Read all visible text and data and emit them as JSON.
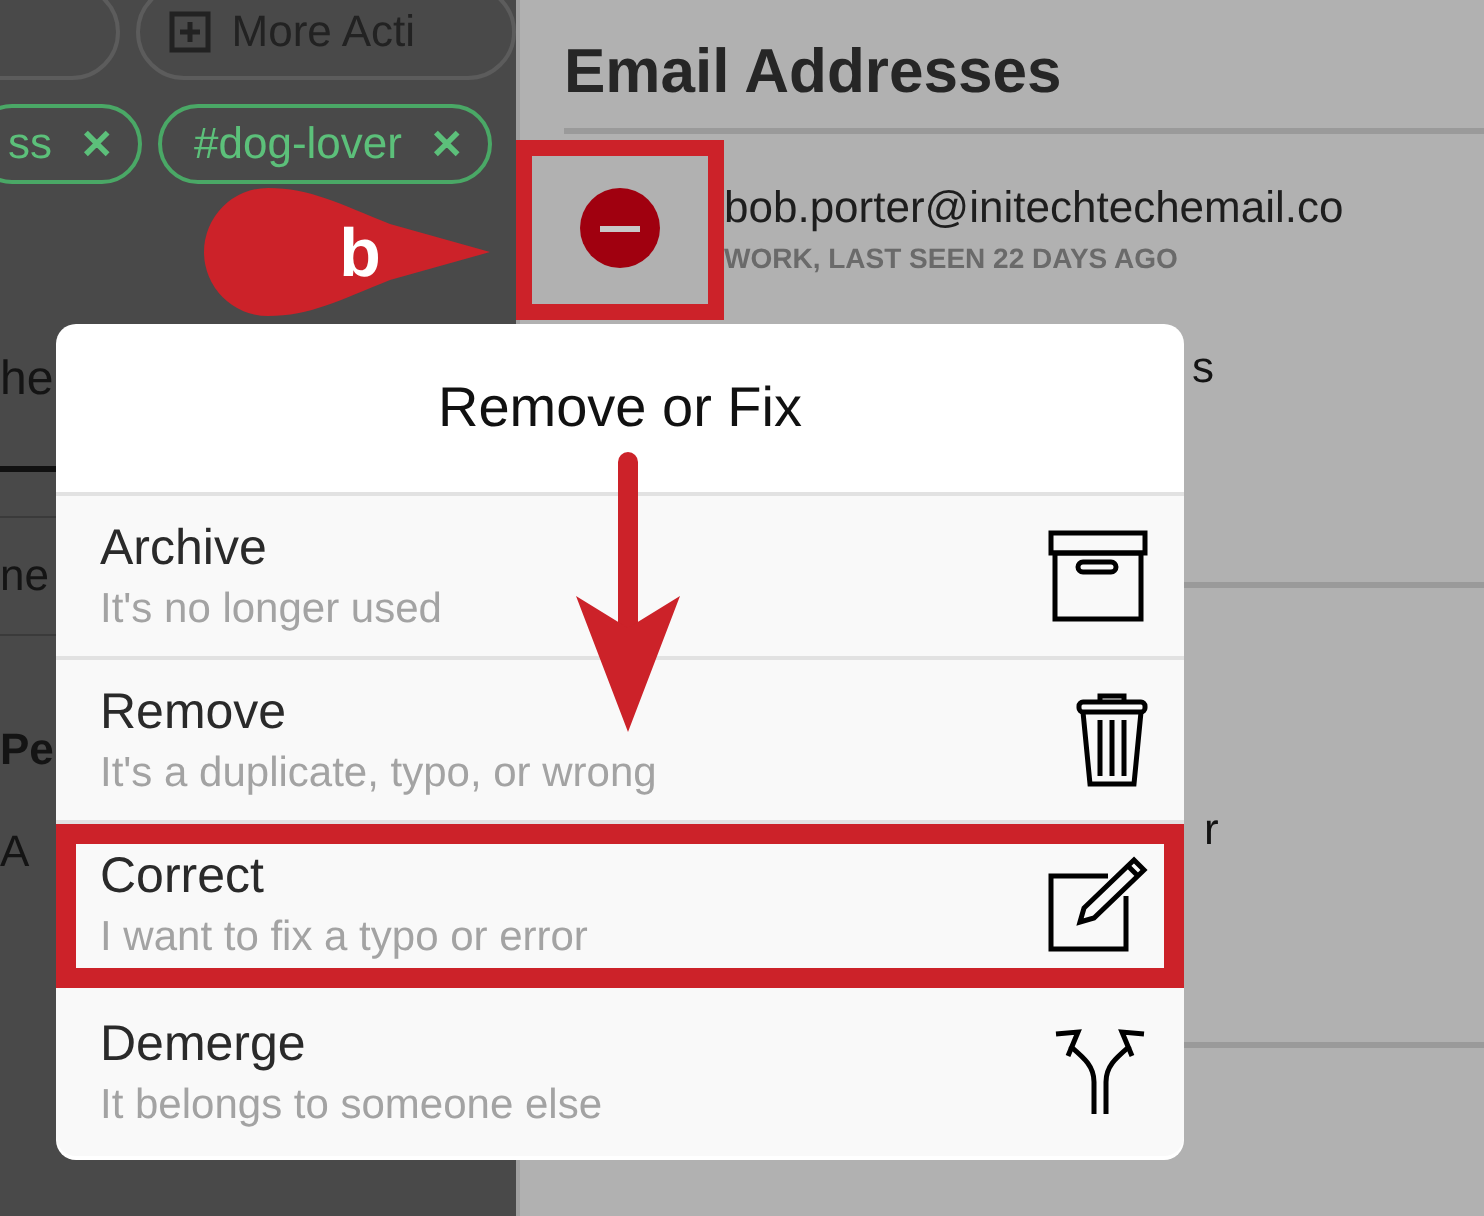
{
  "background": {
    "toolbar_button": "More Acti",
    "tags": [
      {
        "label": "ss",
        "remove": "✕"
      },
      {
        "label": "#dog-lover",
        "remove": "✕"
      }
    ],
    "fragments": [
      "he",
      "ne",
      "Pe",
      "A"
    ]
  },
  "email_panel": {
    "title": "Email Addresses",
    "entry": {
      "address": "bob.porter@initechtechemail.co",
      "meta": "WORK, LAST SEEN 22 DAYS AGO"
    },
    "fragments": [
      "s",
      "r"
    ]
  },
  "popover": {
    "title": "Remove or Fix",
    "options": [
      {
        "kind": "archive",
        "label": "Archive",
        "description": "It's no longer used",
        "highlighted": false
      },
      {
        "kind": "remove",
        "label": "Remove",
        "description": "It's a duplicate, typo, or wrong",
        "highlighted": false
      },
      {
        "kind": "correct",
        "label": "Correct",
        "description": "I want to fix a typo or error",
        "highlighted": true
      },
      {
        "kind": "demerge",
        "label": "Demerge",
        "description": "It belongs to someone else",
        "highlighted": false
      }
    ]
  },
  "annotation": {
    "marker": "b"
  }
}
